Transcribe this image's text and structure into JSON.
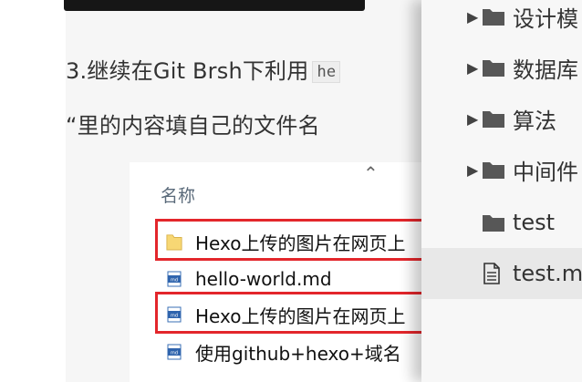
{
  "article": {
    "step_text": "3.继续在Git Brsh下利用",
    "inline_code": "he",
    "note_text": "“里的内容填自己的文件名"
  },
  "explorer": {
    "column_header": "名称",
    "sort_arrow": "^",
    "files": [
      {
        "name": "Hexo上传的图片在网页上",
        "icon": "folder-icon",
        "highlighted": true
      },
      {
        "name": "hello-world.md",
        "icon": "markdown-file-icon",
        "highlighted": false
      },
      {
        "name": "Hexo上传的图片在网页上",
        "icon": "markdown-file-icon",
        "highlighted": true
      },
      {
        "name": "使用github+hexo+域名",
        "icon": "markdown-file-icon",
        "highlighted": false
      }
    ]
  },
  "sidebar": {
    "items": [
      {
        "label": "设计模",
        "type": "folder",
        "expandable": true
      },
      {
        "label": "数据库",
        "type": "folder",
        "expandable": true
      },
      {
        "label": "算法",
        "type": "folder",
        "expandable": true
      },
      {
        "label": "中间件",
        "type": "folder",
        "expandable": true
      },
      {
        "label": "test",
        "type": "folder",
        "expandable": false
      },
      {
        "label": "test.md",
        "type": "file",
        "expandable": false,
        "active": true
      }
    ]
  },
  "colors": {
    "highlight_border": "#e3262b",
    "folder": "#575757",
    "article_bg": "#f6f6f6",
    "sidebar_bg": "#f7f7f7"
  }
}
